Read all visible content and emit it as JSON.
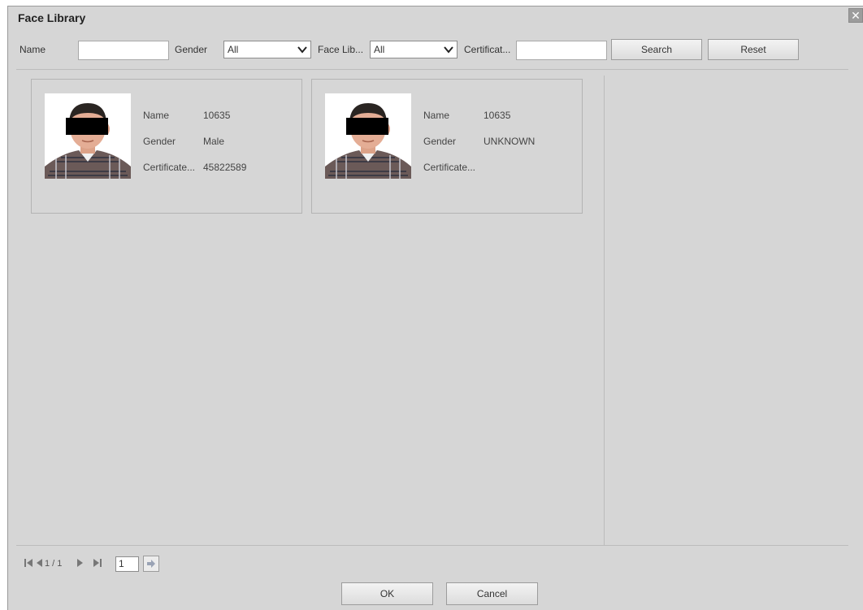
{
  "dialog": {
    "title": "Face Library",
    "close_icon": "close-icon"
  },
  "filters": {
    "name_label": "Name",
    "name_value": "",
    "gender_label": "Gender",
    "gender_value": "All",
    "face_lib_label": "Face Lib...",
    "face_lib_value": "All",
    "certificate_label": "Certificat...",
    "certificate_value": "",
    "search_label": "Search",
    "reset_label": "Reset"
  },
  "cards": [
    {
      "name_key": "Name",
      "name_value": "10635",
      "gender_key": "Gender",
      "gender_value": "Male",
      "cert_key": "Certificate...",
      "cert_value": "45822589"
    },
    {
      "name_key": "Name",
      "name_value": "10635",
      "gender_key": "Gender",
      "gender_value": "UNKNOWN",
      "cert_key": "Certificate...",
      "cert_value": ""
    }
  ],
  "pager": {
    "page_text": "1 / 1",
    "page_input": "1",
    "icons": [
      "first-page-icon",
      "prev-page-icon",
      "next-page-icon",
      "last-page-icon",
      "go-page-icon"
    ]
  },
  "footer": {
    "ok_label": "OK",
    "cancel_label": "Cancel"
  }
}
